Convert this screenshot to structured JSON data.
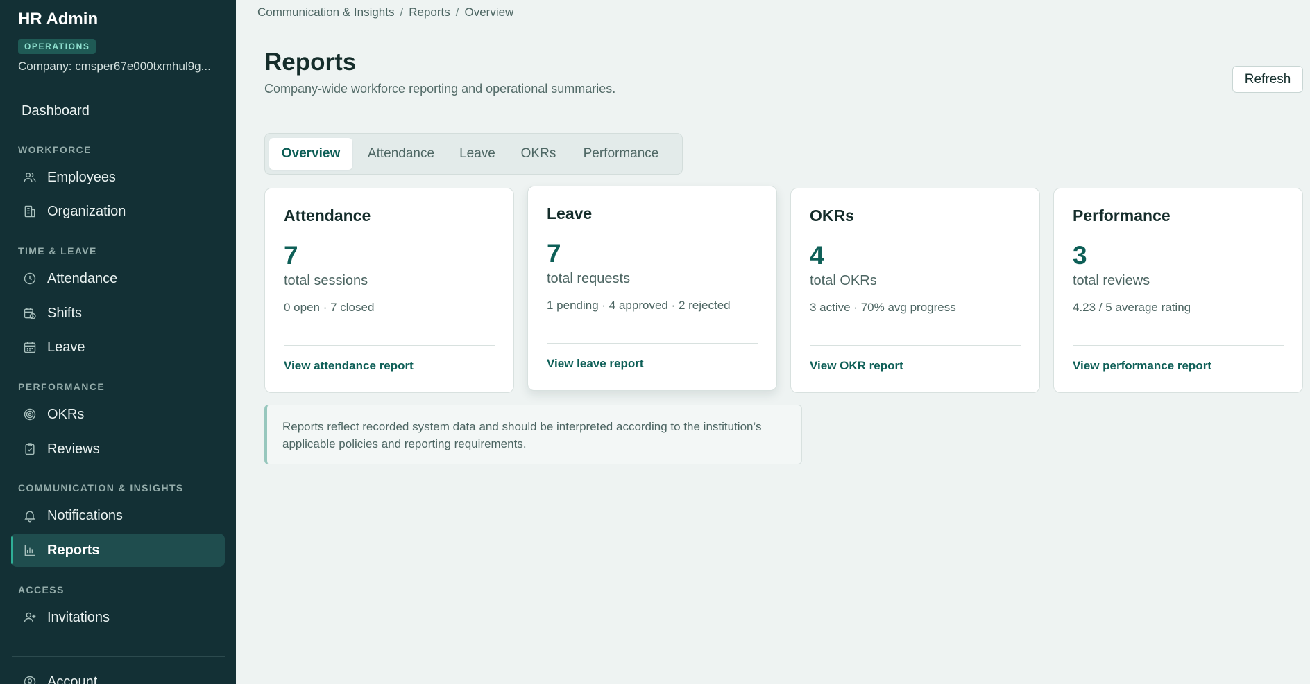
{
  "sidebar": {
    "brand": "HR Admin",
    "badge": "OPERATIONS",
    "company": "Company: cmsper67e000txmhul9g...",
    "dashboard": "Dashboard",
    "sections": {
      "workforce": "WORKFORCE",
      "time_leave": "TIME & LEAVE",
      "performance": "PERFORMANCE",
      "communication": "COMMUNICATION & INSIGHTS",
      "access": "ACCESS"
    },
    "items": {
      "employees": "Employees",
      "organization": "Organization",
      "attendance": "Attendance",
      "shifts": "Shifts",
      "leave": "Leave",
      "okrs": "OKRs",
      "reviews": "Reviews",
      "notifications": "Notifications",
      "reports": "Reports",
      "invitations": "Invitations",
      "account": "Account"
    },
    "icons": {
      "employees": "users-icon",
      "organization": "building-icon",
      "attendance": "clock-icon",
      "shifts": "calendar-clock-icon",
      "leave": "calendar-icon",
      "okrs": "target-icon",
      "reviews": "clipboard-check-icon",
      "notifications": "bell-icon",
      "reports": "bar-chart-icon",
      "invitations": "user-plus-icon",
      "account": "user-circle-icon"
    },
    "active_item": "Reports"
  },
  "breadcrumb": [
    "Communication & Insights",
    "Reports",
    "Overview"
  ],
  "breadcrumb_separator": "/",
  "header": {
    "title": "Reports",
    "subtitle": "Company-wide workforce reporting and operational summaries.",
    "refresh_label": "Refresh"
  },
  "tabs": [
    "Overview",
    "Attendance",
    "Leave",
    "OKRs",
    "Performance"
  ],
  "active_tab": "Overview",
  "cards": [
    {
      "title": "Attendance",
      "value": "7",
      "unit": "total sessions",
      "meta": "0 open · 7 closed",
      "link": "View attendance report"
    },
    {
      "title": "Leave",
      "value": "7",
      "unit": "total requests",
      "meta": "1 pending · 4 approved · 2 rejected",
      "link": "View leave report"
    },
    {
      "title": "OKRs",
      "value": "4",
      "unit": "total OKRs",
      "meta": "3 active · 70% avg progress",
      "link": "View OKR report"
    },
    {
      "title": "Performance",
      "value": "3",
      "unit": "total reviews",
      "meta": "4.23 / 5 average rating",
      "link": "View performance report"
    }
  ],
  "note": "Reports reflect recorded system data and should be interpreted according to the institution’s applicable policies and reporting requirements.",
  "colors": {
    "sidebar_bg": "#133035",
    "accent": "#0e5f57",
    "page_bg": "#eef3f2",
    "active_nav_bg": "#1f4d4e"
  }
}
